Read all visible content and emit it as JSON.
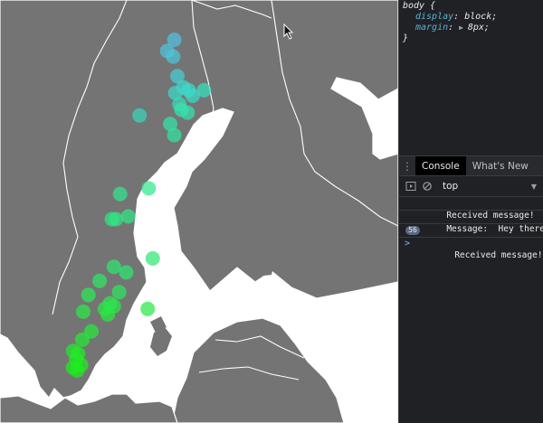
{
  "map": {
    "land_color": "#747474",
    "water_color": "#ffffff",
    "border_color": "#ffffff",
    "points": [
      {
        "lat": 68.4,
        "lon": 18.9,
        "color": "#52c0e0"
      },
      {
        "lat": 68.0,
        "lon": 18.2,
        "color": "#4ec4dc"
      },
      {
        "lat": 67.8,
        "lon": 18.8,
        "color": "#4cc6da"
      },
      {
        "lat": 67.1,
        "lon": 19.2,
        "color": "#45d0d6"
      },
      {
        "lat": 66.7,
        "lon": 19.8,
        "color": "#3fd8d0"
      },
      {
        "lat": 66.6,
        "lon": 20.3,
        "color": "#3cdcc8"
      },
      {
        "lat": 66.6,
        "lon": 21.8,
        "color": "#38e0c0"
      },
      {
        "lat": 66.5,
        "lon": 19.0,
        "color": "#3adac8"
      },
      {
        "lat": 66.4,
        "lon": 20.7,
        "color": "#3adcc6"
      },
      {
        "lat": 66.1,
        "lon": 19.4,
        "color": "#38deb8"
      },
      {
        "lat": 65.9,
        "lon": 19.6,
        "color": "#36e2b0"
      },
      {
        "lat": 65.8,
        "lon": 20.2,
        "color": "#36e2b0"
      },
      {
        "lat": 65.7,
        "lon": 15.5,
        "color": "#3cd6b8"
      },
      {
        "lat": 65.4,
        "lon": 18.5,
        "color": "#34e4a8"
      },
      {
        "lat": 65.0,
        "lon": 18.9,
        "color": "#32e6a0"
      },
      {
        "lat": 63.1,
        "lon": 16.4,
        "color": "#30e690"
      },
      {
        "lat": 62.9,
        "lon": 13.6,
        "color": "#32e690"
      },
      {
        "lat": 62.0,
        "lon": 12.8,
        "color": "#30e684"
      },
      {
        "lat": 62.0,
        "lon": 13.2,
        "color": "#30e684"
      },
      {
        "lat": 62.1,
        "lon": 14.4,
        "color": "#30e684"
      },
      {
        "lat": 60.6,
        "lon": 16.8,
        "color": "#30e674"
      },
      {
        "lat": 60.3,
        "lon": 13.0,
        "color": "#2fe870"
      },
      {
        "lat": 60.1,
        "lon": 14.2,
        "color": "#2fe86c"
      },
      {
        "lat": 59.8,
        "lon": 11.6,
        "color": "#2ee864"
      },
      {
        "lat": 59.4,
        "lon": 13.5,
        "color": "#2ce85e"
      },
      {
        "lat": 59.3,
        "lon": 10.5,
        "color": "#2eea58"
      },
      {
        "lat": 59.0,
        "lon": 12.6,
        "color": "#2ce850"
      },
      {
        "lat": 58.9,
        "lon": 13.0,
        "color": "#2ae84c"
      },
      {
        "lat": 58.8,
        "lon": 12.1,
        "color": "#2ae84a"
      },
      {
        "lat": 58.8,
        "lon": 16.3,
        "color": "#2ae848"
      },
      {
        "lat": 58.7,
        "lon": 10.0,
        "color": "#2aea46"
      },
      {
        "lat": 58.6,
        "lon": 12.4,
        "color": "#28ea42"
      },
      {
        "lat": 58.0,
        "lon": 10.8,
        "color": "#26ea3a"
      },
      {
        "lat": 57.7,
        "lon": 9.9,
        "color": "#24ea34"
      },
      {
        "lat": 57.3,
        "lon": 9.0,
        "color": "#22ea2e"
      },
      {
        "lat": 57.2,
        "lon": 9.5,
        "color": "#22ec2a"
      },
      {
        "lat": 57.0,
        "lon": 9.3,
        "color": "#20ec26"
      },
      {
        "lat": 56.8,
        "lon": 9.8,
        "color": "#1eec22"
      },
      {
        "lat": 56.7,
        "lon": 9.0,
        "color": "#1eee1e"
      },
      {
        "lat": 56.6,
        "lon": 9.4,
        "color": "#1cee1a"
      }
    ]
  },
  "devtools": {
    "styles": {
      "selector": "body {",
      "props": [
        {
          "name": "display",
          "value": "block;"
        },
        {
          "name": "margin",
          "value": "8px;"
        }
      ],
      "close": "}"
    },
    "tabs": [
      {
        "label": "Console",
        "active": true
      },
      {
        "label": "What's New",
        "active": false
      }
    ],
    "toolbar": {
      "context": "top"
    },
    "console": {
      "messages": [
        {
          "text": "Received message!",
          "badge": ""
        },
        {
          "text": "Message:  Hey there!",
          "badge": ""
        },
        {
          "text": "Received message!",
          "badge": "56"
        }
      ],
      "prompt": ">"
    }
  }
}
